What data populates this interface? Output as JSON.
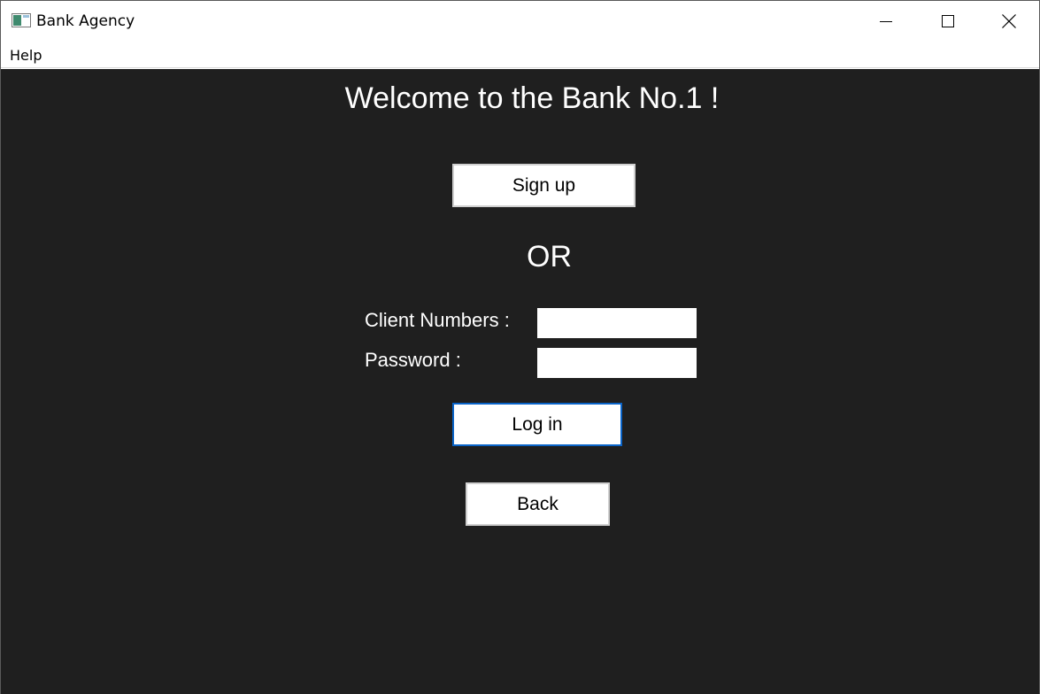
{
  "window": {
    "title": "Bank Agency",
    "controls": [
      "minimize",
      "maximize",
      "close"
    ]
  },
  "menu": {
    "items": [
      "Help"
    ]
  },
  "main": {
    "welcome": "Welcome to the Bank No.1 !",
    "signup_label": "Sign up",
    "or_label": "OR",
    "client_label": "Client Numbers :",
    "password_label": "Password :",
    "client_value": "",
    "password_value": "",
    "login_label": "Log in",
    "back_label": "Back"
  },
  "colors": {
    "background": "#1f1f1f",
    "text": "#ffffff",
    "focus_border": "#0a64c8"
  }
}
